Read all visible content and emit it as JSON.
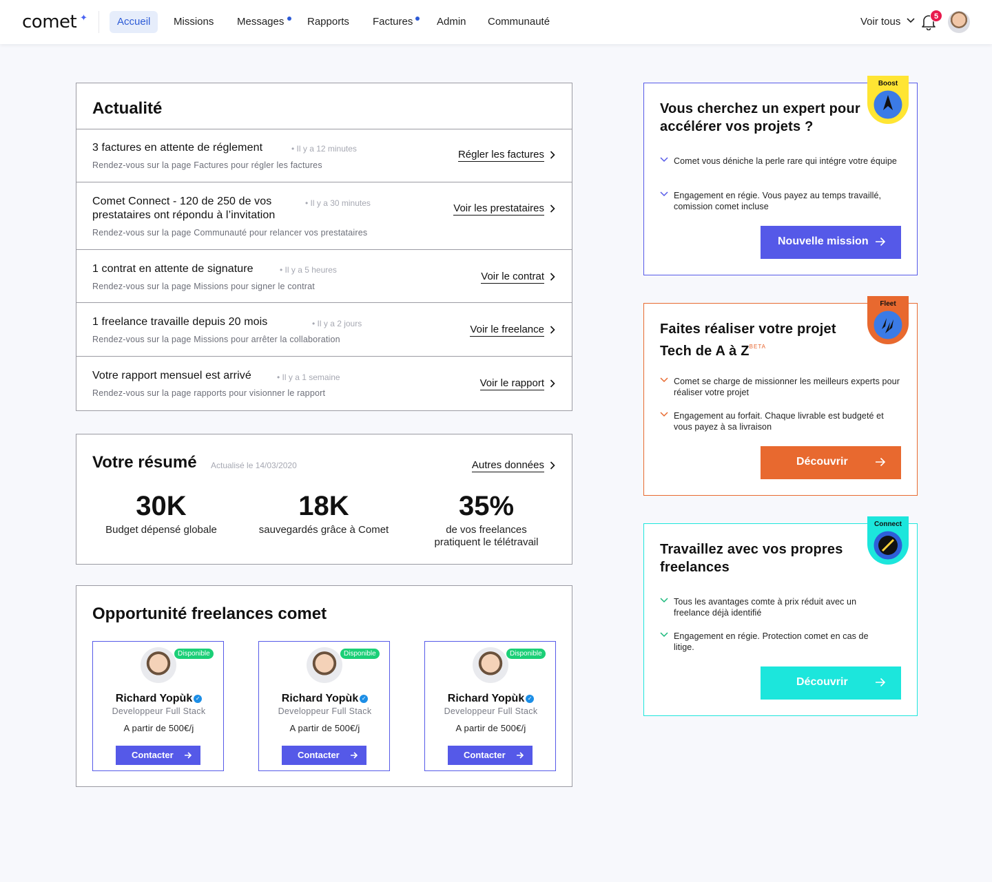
{
  "nav": {
    "logo": "comet",
    "items": [
      {
        "label": "Accueil"
      },
      {
        "label": "Missions"
      },
      {
        "label": "Messages"
      },
      {
        "label": "Rapports"
      },
      {
        "label": "Factures"
      },
      {
        "label": "Admin"
      },
      {
        "label": "Communauté"
      }
    ],
    "voir_tous": "Voir tous",
    "notif_count": "5"
  },
  "actualite": {
    "title": "Actualité",
    "rows": [
      {
        "title": "3 factures en attente de réglement",
        "time": "• Il y a 12 minutes",
        "sub": "Rendez-vous sur la page Factures pour régler les factures",
        "link": "Régler les factures"
      },
      {
        "title": "Comet Connect - 120 de 250 de vos prestataires ont répondu à l’invitation",
        "time": "• Il y a 30 minutes",
        "sub": "Rendez-vous sur la page Communauté pour relancer vos prestataires",
        "link": "Voir les prestataires"
      },
      {
        "title": "1 contrat en attente de signature",
        "time": "• Il y a 5 heures",
        "sub": "Rendez-vous sur la page Missions pour signer le contrat",
        "link": "Voir le contrat"
      },
      {
        "title": "1 freelance travaille depuis 20 mois",
        "time": "• Il y a 2 jours",
        "sub": "Rendez-vous sur la page Missions pour arrêter la collaboration",
        "link": "Voir le freelance"
      },
      {
        "title": "Votre rapport mensuel est arrivé",
        "time": "• Il y a 1 semaine",
        "sub": "Rendez-vous sur la page rapports pour visionner le rapport",
        "link": "Voir le rapport"
      }
    ]
  },
  "resume": {
    "title": "Votre résumé",
    "updated": "Actualisé le 14/03/2020",
    "link": "Autres données",
    "stats": [
      {
        "value": "30K",
        "label": "Budget dépensé globale"
      },
      {
        "value": "18K",
        "label": "sauvegardés grâce à Comet"
      },
      {
        "value": "35%",
        "label": "de vos freelances pratiquent le télétravail"
      }
    ]
  },
  "opportunites": {
    "title": "Opportunité freelances comet",
    "freelances": [
      {
        "badge": "Disponible",
        "name": "Richard Yopùk",
        "role": "Developpeur Full Stack",
        "price": "A partir de 500€/j",
        "button": "Contacter"
      },
      {
        "badge": "Disponible",
        "name": "Richard Yopùk",
        "role": "Developpeur Full Stack",
        "price": "A partir de 500€/j",
        "button": "Contacter"
      },
      {
        "badge": "Disponible",
        "name": "Richard Yopùk",
        "role": "Developpeur Full Stack",
        "price": "A partir de 500€/j",
        "button": "Contacter"
      }
    ]
  },
  "offers": [
    {
      "badge": "Boost",
      "title": "Vous cherchez un expert pour accélérer vos projets ?",
      "title_sup": "",
      "bullets": [
        "Comet vous déniche la perle rare qui intégre votre équipe",
        "Engagement en régie. Vous payez au temps travaillé, comission comet incluse"
      ],
      "button": "Nouvelle mission",
      "color": "#5559e8",
      "badge_color": "#ffe533"
    },
    {
      "badge": "Fleet",
      "title": "Faites réaliser votre projet Tech de A à Z",
      "title_sup": "BETA",
      "bullets": [
        "Comet se charge de missionner les meilleurs experts pour réaliser votre projet",
        "Engagement au forfait. Chaque livrable est budgeté et vous payez à sa livraison"
      ],
      "button": "Découvrir",
      "color": "#e8692f",
      "badge_color": "#e8692f"
    },
    {
      "badge": "Connect",
      "title": "Travaillez avec vos propres freelances",
      "title_sup": "",
      "bullets": [
        "Tous les avantages comte à prix réduit avec un freelance déjà identifié",
        "Engagement en régie. Protection comet en cas de litige."
      ],
      "button": "Découvrir",
      "color": "#1ce6dc",
      "badge_color": "#1ce6dc"
    }
  ]
}
